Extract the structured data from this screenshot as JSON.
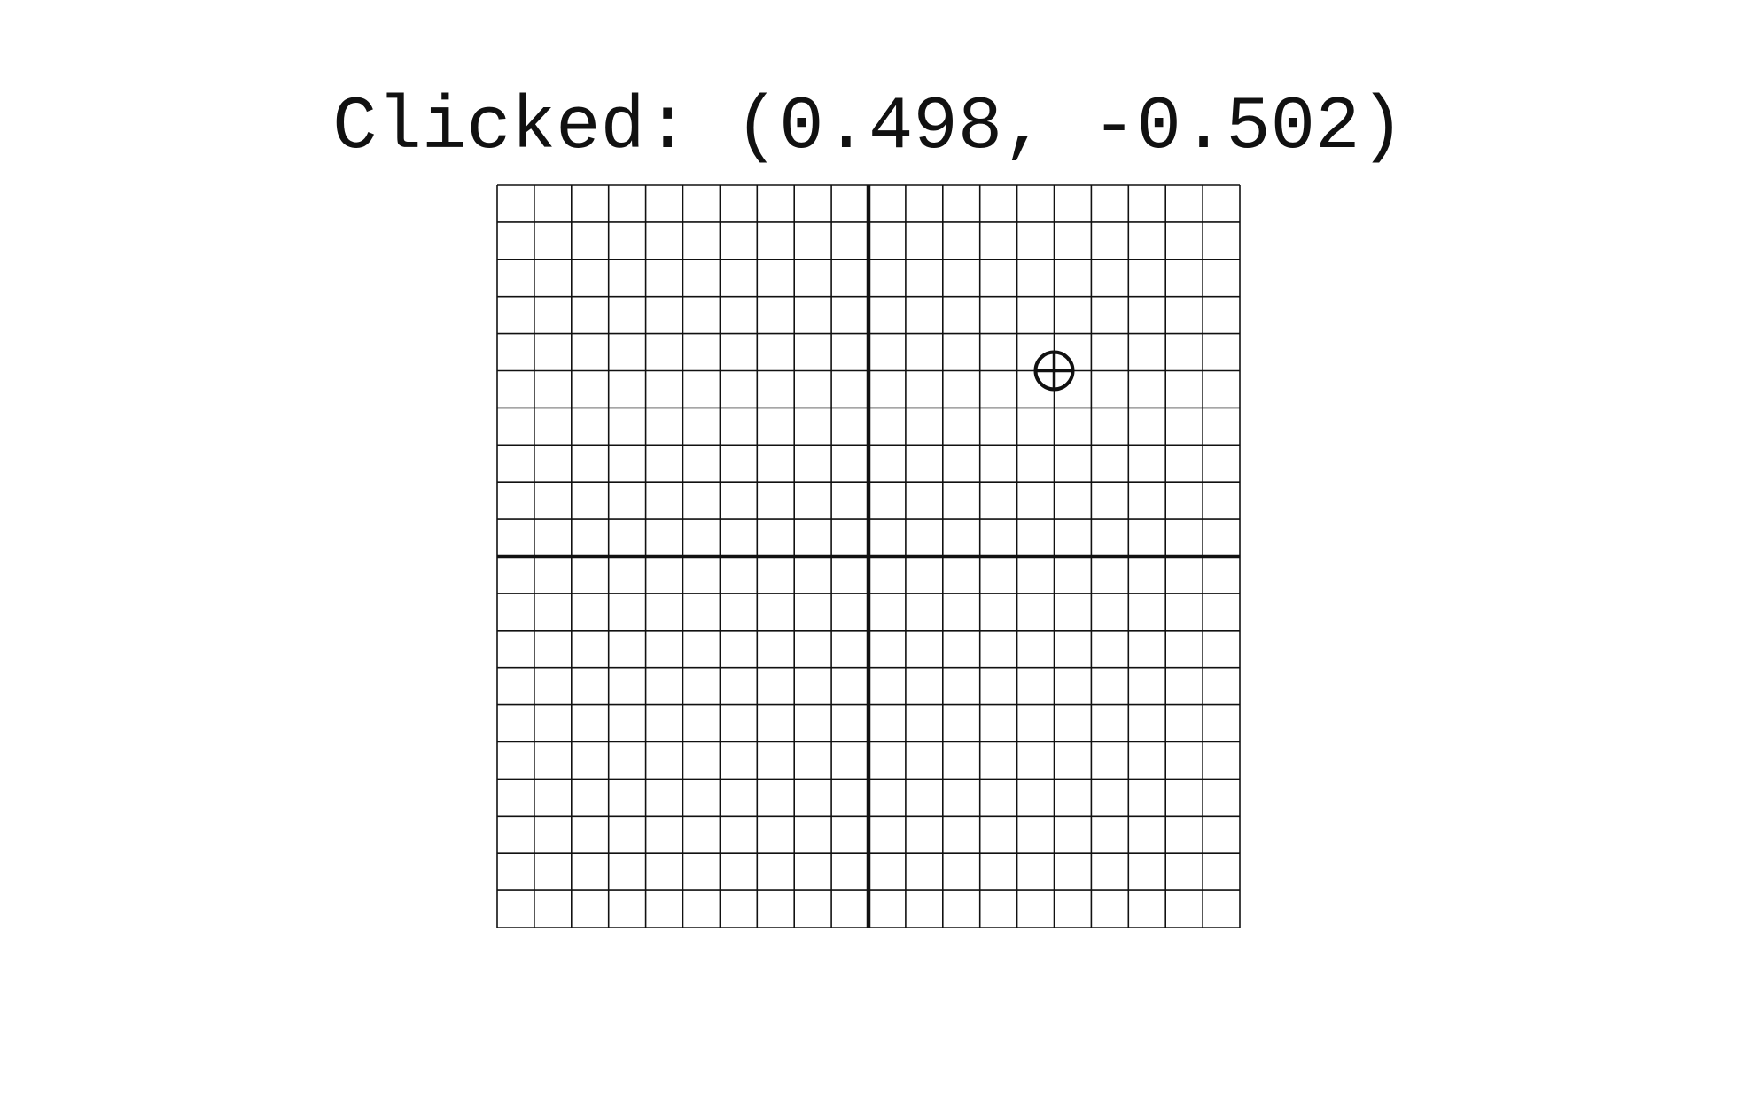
{
  "readout": {
    "text": "Clicked: (0.498, -0.502)"
  },
  "plane": {
    "x_range": [
      -1,
      1
    ],
    "y_range": [
      -1,
      1
    ],
    "grid_divisions": 20,
    "axes_visible": true,
    "grid_visible": true,
    "line_color": "#111111",
    "marker_icon": "crosshair-circle-icon",
    "marker": {
      "x": 0.5,
      "y": 0.5
    }
  }
}
